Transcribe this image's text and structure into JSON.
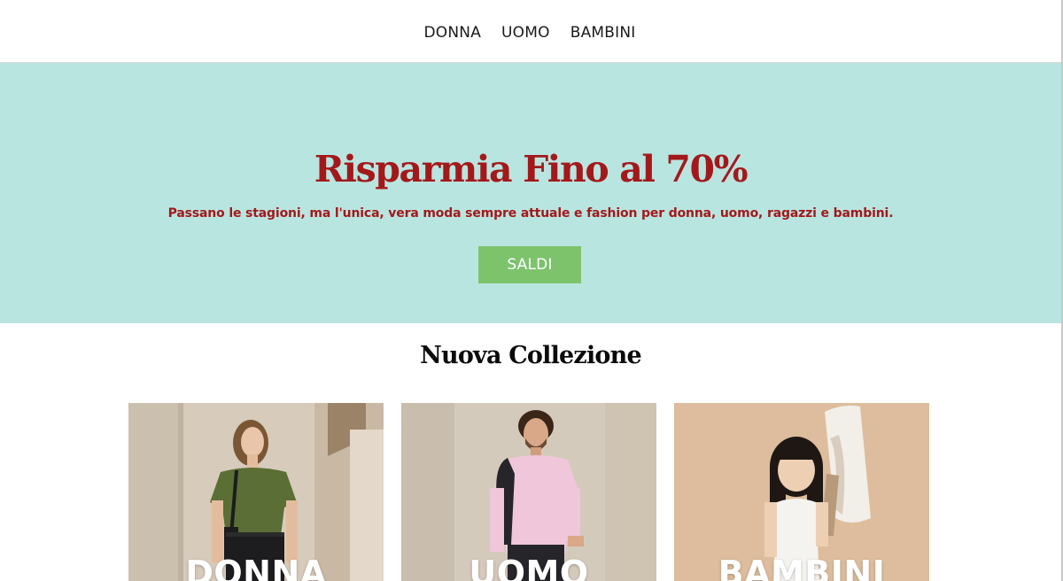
{
  "nav": {
    "items": [
      {
        "label": "DONNA"
      },
      {
        "label": "UOMO"
      },
      {
        "label": "BAMBINI"
      }
    ]
  },
  "hero": {
    "title": "Risparmia Fino al 70%",
    "subtitle": "Passano le stagioni, ma l'unica, vera moda sempre attuale e fashion per donna, uomo, ragazzi e bambini.",
    "button_label": "SALDI",
    "background_color": "#b9e5e0",
    "text_color": "#a3191b",
    "button_color": "#7cc36c"
  },
  "collection": {
    "title": "Nuova Collezione",
    "cards": [
      {
        "label": "DONNA"
      },
      {
        "label": "UOMO"
      },
      {
        "label": "BAMBINI"
      }
    ]
  }
}
